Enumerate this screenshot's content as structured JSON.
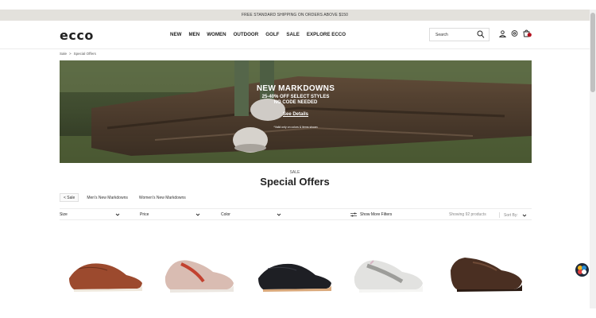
{
  "promo": {
    "text": "FREE STANDARD SHIPPING ON ORDERS ABOVE $150"
  },
  "header": {
    "logo": "ecco",
    "nav": [
      "NEW",
      "MEN",
      "WOMEN",
      "OUTDOOR",
      "GOLF",
      "SALE",
      "EXPLORE ECCO"
    ],
    "search_placeholder": "Search",
    "icons": [
      "search-icon",
      "account-icon",
      "location-icon",
      "bag-icon"
    ],
    "accent": "#b3121f"
  },
  "breadcrumb": {
    "parent": "Sale",
    "separator": ">",
    "current": "Special Offers"
  },
  "hero": {
    "title": "NEW MARKDOWNS",
    "line1": "25-40% OFF SELECT STYLES",
    "line2": "NO CODE NEEDED",
    "link": "See Details",
    "note": "*Valid only on colors & items shown"
  },
  "section": {
    "eyebrow": "SALE",
    "title": "Special Offers"
  },
  "chips": [
    "< Sale",
    "Men's New Markdowns",
    "Women's New Markdowns"
  ],
  "filters": {
    "size": "Size",
    "price": "Price",
    "color": "Color",
    "more": "Show More Filters",
    "count": "Showing 92 products",
    "sort": "Sort By:"
  },
  "products": [
    {
      "name": "brown-leather-derby-shoe"
    },
    {
      "name": "pink-red-hiking-sneaker"
    },
    {
      "name": "black-leather-derby-shoe"
    },
    {
      "name": "grey-white-running-sneaker"
    },
    {
      "name": "dark-brown-loafer"
    }
  ]
}
